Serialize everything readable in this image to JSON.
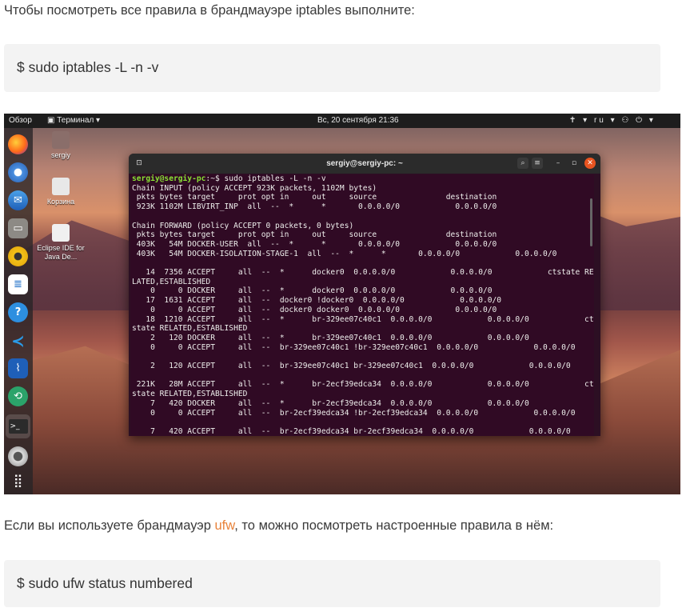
{
  "intro_text": "Чтобы посмотреть все правила в брандмауэре iptables выполните:",
  "command1": "$  sudo iptables -L -n -v",
  "para2": {
    "before": "Если вы используете брандмауэр ",
    "link": "ufw",
    "after": ", то можно посмотреть настроенные правила в нём:"
  },
  "command2": "$ sudo ufw status numbered",
  "screenshot": {
    "topbar": {
      "overview": "Обзор",
      "terminal_menu": "▣ Терминал ▾",
      "clock": "Вс, 20 сентября  21:36",
      "indicators": "✝ ▾   ru ▾   ⚇  ⏻ ▾"
    },
    "desktop_icons": [
      {
        "label": "sergiy"
      },
      {
        "label": "Корзина"
      },
      {
        "label": "Eclipse IDE for Java De..."
      }
    ],
    "terminal": {
      "title": "sergiy@sergiy-pc: ~",
      "prompt": "sergiy@sergiy-pc",
      "prompt_tail": ":~$ sudo iptables -L -n -v",
      "output": "Chain INPUT (policy ACCEPT 923K packets, 1102M bytes)\n pkts bytes target     prot opt in     out     source               destination\n 923K 1102M LIBVIRT_INP  all  --  *      *       0.0.0.0/0            0.0.0.0/0\n\nChain FORWARD (policy ACCEPT 0 packets, 0 bytes)\n pkts bytes target     prot opt in     out     source               destination\n 403K   54M DOCKER-USER  all  --  *      *       0.0.0.0/0            0.0.0.0/0\n 403K   54M DOCKER-ISOLATION-STAGE-1  all  --  *      *       0.0.0.0/0            0.0.0.0/0\n\n   14  7356 ACCEPT     all  --  *      docker0  0.0.0.0/0            0.0.0.0/0            ctstate RE\nLATED,ESTABLISHED\n    0     0 DOCKER     all  --  *      docker0  0.0.0.0/0            0.0.0.0/0\n   17  1631 ACCEPT     all  --  docker0 !docker0  0.0.0.0/0            0.0.0.0/0\n    0     0 ACCEPT     all  --  docker0 docker0  0.0.0.0/0            0.0.0.0/0\n   18  1210 ACCEPT     all  --  *      br-329ee07c40c1  0.0.0.0/0            0.0.0.0/0            ct\nstate RELATED,ESTABLISHED\n    2   120 DOCKER     all  --  *      br-329ee07c40c1  0.0.0.0/0            0.0.0.0/0\n    0     0 ACCEPT     all  --  br-329ee07c40c1 !br-329ee07c40c1  0.0.0.0/0            0.0.0.0/0\n\n    2   120 ACCEPT     all  --  br-329ee07c40c1 br-329ee07c40c1  0.0.0.0/0            0.0.0.0/0\n\n 221K   28M ACCEPT     all  --  *      br-2ecf39edca34  0.0.0.0/0            0.0.0.0/0            ct\nstate RELATED,ESTABLISHED\n    7   420 DOCKER     all  --  *      br-2ecf39edca34  0.0.0.0/0            0.0.0.0/0\n    0     0 ACCEPT     all  --  br-2ecf39edca34 !br-2ecf39edca34  0.0.0.0/0            0.0.0.0/0\n\n    7   420 ACCEPT     all  --  br-2ecf39edca34 br-2ecf39edca34  0.0.0.0/0            0.0.0.0/0"
    },
    "dock_icons": [
      "firefox-icon",
      "chromium-icon",
      "thunderbird-icon",
      "files-icon",
      "rhythmbox-icon",
      "writer-icon",
      "help-icon",
      "vscode-icon",
      "monitor-icon",
      "appstore-icon",
      "terminal-icon",
      "settings-icon",
      "apps-grid-icon"
    ]
  }
}
